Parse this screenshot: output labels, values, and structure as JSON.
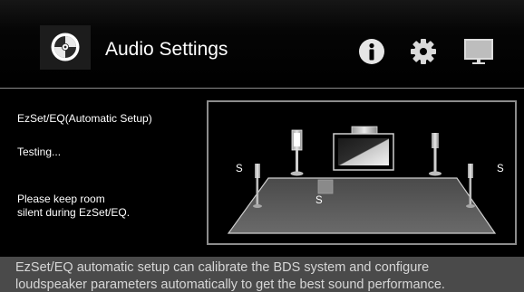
{
  "header": {
    "title": "Audio Settings",
    "icons": {
      "audio": "speaker-disc-icon",
      "info": "info-icon",
      "settings": "gear-icon",
      "display": "monitor-icon"
    }
  },
  "panel": {
    "setup_label": "EzSet/EQ(Automatic Setup)",
    "status": "Testing...",
    "instruction_line1": "Please keep room",
    "instruction_line2": "silent during EzSet/EQ."
  },
  "diagram": {
    "left_label": "S",
    "right_label": "S",
    "sub_label": "S"
  },
  "description": {
    "line1": "EzSet/EQ automatic setup can calibrate the BDS system and configure",
    "line2": "loudspeaker parameters automatically to get the best sound performance."
  },
  "colors": {
    "background": "#000000",
    "footer": "#4a4a4a",
    "accent_text": "#ffffff"
  }
}
